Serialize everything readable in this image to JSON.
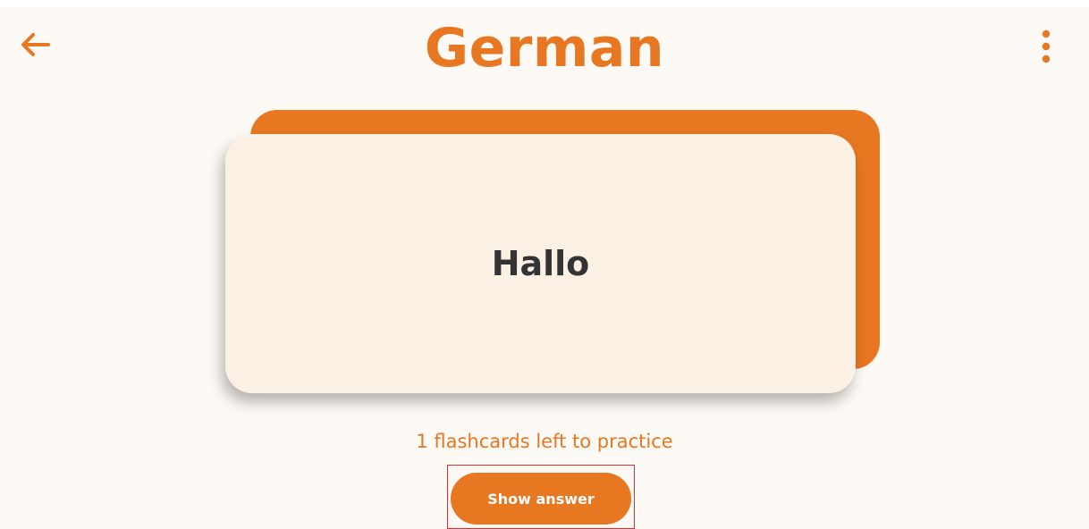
{
  "app": {
    "title": "German"
  },
  "toolbar": {
    "back_icon": "arrow-left-icon",
    "menu_icon": "more-vertical-icon"
  },
  "card": {
    "front_text": "Hallo"
  },
  "status": {
    "remaining_text": "1 flashcards left to practice"
  },
  "actions": {
    "show_answer_label": "Show answer"
  },
  "colors": {
    "accent": "#e87722",
    "background": "#fdf9f4",
    "card_front": "#faf0e3",
    "card_text": "#333333",
    "button_text": "#ffffff",
    "highlight_outline": "#d92f2f"
  }
}
